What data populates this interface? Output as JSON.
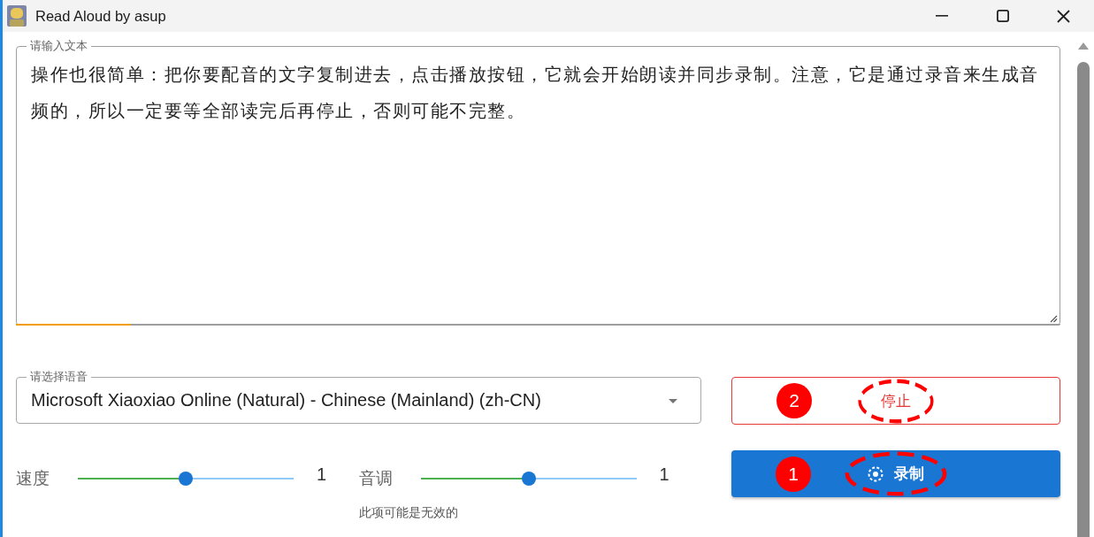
{
  "window": {
    "title": "Read Aloud by asup"
  },
  "text_input": {
    "label": "请输入文本",
    "value": "操作也很简单：把你要配音的文字复制进去，点击播放按钮，它就会开始朗读并同步录制。注意，它是通过录音来生成音频的，所以一定要等全部读完后再停止，否则可能不完整。",
    "progress": {
      "level": 0.11
    }
  },
  "voice_select": {
    "label": "请选择语音",
    "value": "Microsoft Xiaoxiao Online (Natural) - Chinese (Mainland) (zh-CN)"
  },
  "sliders": [
    {
      "label": "速度",
      "level": 0.5,
      "reading": "1"
    },
    {
      "label": "音调",
      "level": 0.5,
      "reading": "1",
      "hint": "此项可能是无效的"
    }
  ],
  "buttons": [
    {
      "kind": "outlined",
      "label": "停止",
      "callout": "2",
      "highlighted": true
    },
    {
      "kind": "contained",
      "label": "录制",
      "callout": "1",
      "highlighted": true
    }
  ]
}
